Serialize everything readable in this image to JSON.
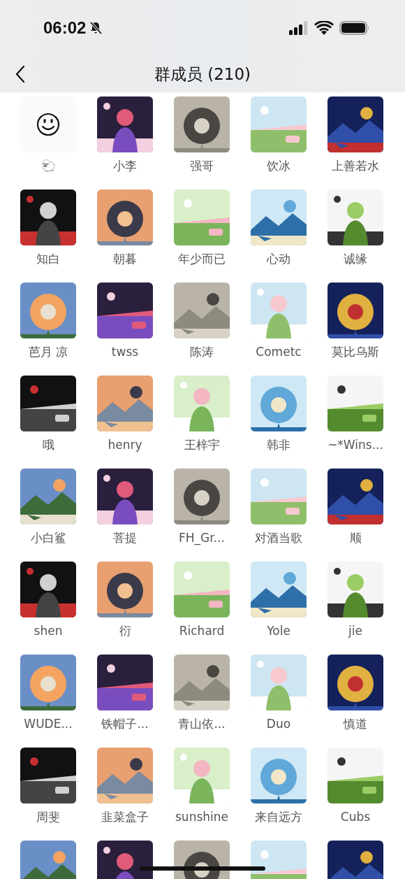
{
  "status_bar": {
    "time": "06:02",
    "muted": true
  },
  "header": {
    "title": "群成员 (210)"
  },
  "members": [
    {
      "name": "🐑",
      "kind": "smiley"
    },
    {
      "name": "小李",
      "kind": "picture"
    },
    {
      "name": "强哥",
      "kind": "picture"
    },
    {
      "name": "饮冰",
      "kind": "picture"
    },
    {
      "name": "上善若水",
      "kind": "picture"
    },
    {
      "name": "知白",
      "kind": "picture"
    },
    {
      "name": "朝暮",
      "kind": "picture"
    },
    {
      "name": "年少而已",
      "kind": "picture"
    },
    {
      "name": "心动",
      "kind": "picture"
    },
    {
      "name": "诚缘",
      "kind": "picture"
    },
    {
      "name": "芭月 凉",
      "kind": "picture"
    },
    {
      "name": "twss",
      "kind": "picture"
    },
    {
      "name": "陈涛",
      "kind": "picture"
    },
    {
      "name": "Cometc",
      "kind": "picture"
    },
    {
      "name": "莫比乌斯",
      "kind": "picture"
    },
    {
      "name": "哦",
      "kind": "picture"
    },
    {
      "name": "henry",
      "kind": "picture"
    },
    {
      "name": "王梓宇",
      "kind": "picture"
    },
    {
      "name": "韩非",
      "kind": "picture"
    },
    {
      "name": "~*Wins...",
      "kind": "picture"
    },
    {
      "name": "小白鲨",
      "kind": "picture"
    },
    {
      "name": "菩提",
      "kind": "picture"
    },
    {
      "name": "FH_Gr...",
      "kind": "picture"
    },
    {
      "name": "对酒当歌",
      "kind": "picture"
    },
    {
      "name": "顺",
      "kind": "picture"
    },
    {
      "name": "shen",
      "kind": "picture"
    },
    {
      "name": "衍",
      "kind": "picture"
    },
    {
      "name": "Richard",
      "kind": "picture"
    },
    {
      "name": "Yole",
      "kind": "picture"
    },
    {
      "name": "jie",
      "kind": "picture"
    },
    {
      "name": "WUDE...",
      "kind": "picture"
    },
    {
      "name": "铁帽子...",
      "kind": "picture"
    },
    {
      "name": "青山依...",
      "kind": "picture"
    },
    {
      "name": "Duo",
      "kind": "picture"
    },
    {
      "name": "慎道",
      "kind": "picture"
    },
    {
      "name": "周斐",
      "kind": "picture"
    },
    {
      "name": "韭菜盒子",
      "kind": "picture"
    },
    {
      "name": "sunshine",
      "kind": "picture"
    },
    {
      "name": "来自远方",
      "kind": "picture"
    },
    {
      "name": "Cubs",
      "kind": "picture"
    },
    {
      "kind": "picture"
    },
    {
      "kind": "picture"
    },
    {
      "kind": "picture"
    },
    {
      "kind": "picture"
    },
    {
      "kind": "picture"
    }
  ]
}
